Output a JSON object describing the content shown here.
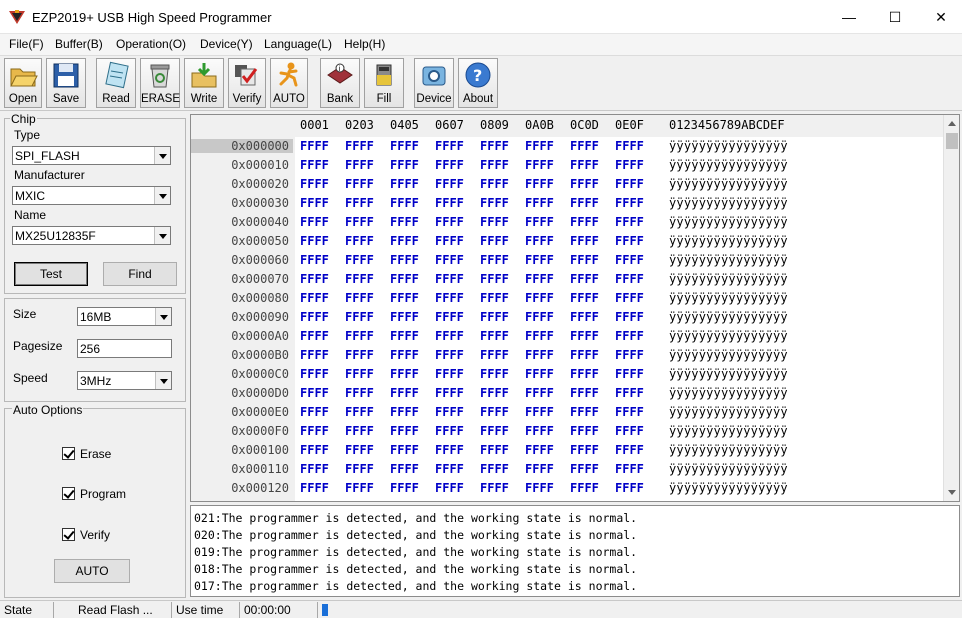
{
  "window": {
    "title": "EZP2019+ USB High Speed Programmer",
    "min": "—",
    "max": "☐",
    "close": "✕"
  },
  "menu": [
    "File(F)",
    "Buffer(B)",
    "Operation(O)",
    "Device(Y)",
    "Language(L)",
    "Help(H)"
  ],
  "toolbar": [
    "Open",
    "Save",
    "Read",
    "ERASE",
    "Write",
    "Verify",
    "AUTO",
    "Bank",
    "Fill",
    "Device",
    "About"
  ],
  "chip": {
    "group_title": "Chip",
    "type_label": "Type",
    "type_value": "SPI_FLASH",
    "manufacturer_label": "Manufacturer",
    "manufacturer_value": "MXIC",
    "name_label": "Name",
    "name_value": "MX25U12835F",
    "test_button": "Test",
    "find_button": "Find"
  },
  "params": {
    "size_label": "Size",
    "size_value": "16MB",
    "pagesize_label": "Pagesize",
    "pagesize_value": "256",
    "speed_label": "Speed",
    "speed_value": "3MHz"
  },
  "auto_options": {
    "title": "Auto Options",
    "erase": "Erase",
    "program": "Program",
    "verify": "Verify",
    "auto_button": "AUTO"
  },
  "hex": {
    "header_cols": [
      "0001",
      "0203",
      "0405",
      "0607",
      "0809",
      "0A0B",
      "0C0D",
      "0E0F"
    ],
    "ascii_header": "0123456789ABCDEF",
    "addresses": [
      "0x000000",
      "0x000010",
      "0x000020",
      "0x000030",
      "0x000040",
      "0x000050",
      "0x000060",
      "0x000070",
      "0x000080",
      "0x000090",
      "0x0000A0",
      "0x0000B0",
      "0x0000C0",
      "0x0000D0",
      "0x0000E0",
      "0x0000F0",
      "0x000100",
      "0x000110",
      "0x000120"
    ],
    "word": "FFFF",
    "ascii": "ÿÿÿÿÿÿÿÿÿÿÿÿÿÿÿÿ"
  },
  "log": [
    "021:The programmer is detected, and the working state is normal.",
    "020:The programmer is detected, and the working state is normal.",
    "019:The programmer is detected, and the working state is normal.",
    "018:The programmer is detected, and the working state is normal.",
    "017:The programmer is detected, and the working state is normal."
  ],
  "status": {
    "state_label": "State",
    "state_value": "Read Flash ...",
    "time_label": "Use time",
    "time_value": "00:00:00",
    "progress": 0.01
  }
}
